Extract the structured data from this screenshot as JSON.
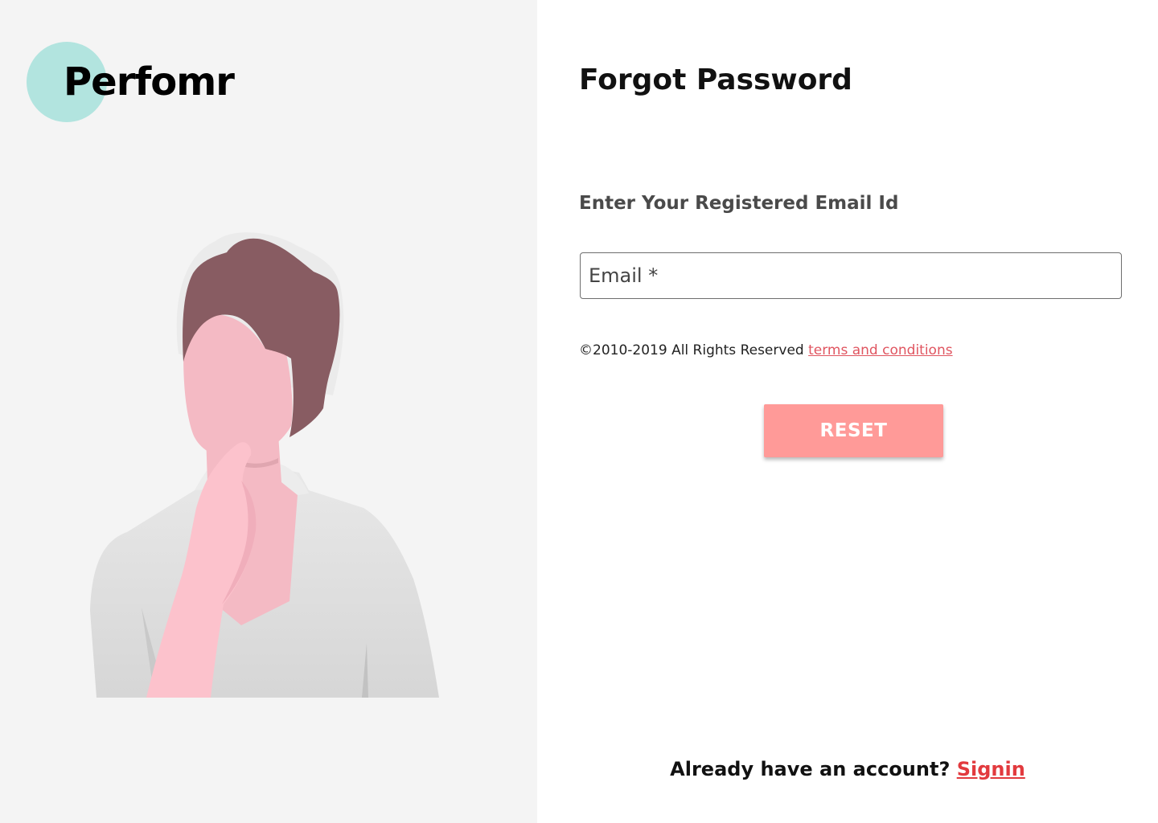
{
  "brand": {
    "name": "Perfomr",
    "circle_color": "#b2e4df"
  },
  "illustration": {
    "subject": "person-thinking-illustration",
    "hair_color": "#885c62",
    "skin_color": "#f4bac4",
    "hand_color": "#fcc2cc",
    "shirt_color": "#e0e0e0"
  },
  "form": {
    "title": "Forgot Password",
    "field_heading": "Enter Your Registered Email Id",
    "email_placeholder": "Email *",
    "email_value": ""
  },
  "footer_note": {
    "copyright": "©2010-2019 All Rights Reserved",
    "terms_link": "terms and conditions",
    "terms_color": "#e05560"
  },
  "actions": {
    "reset_label": "RESET",
    "reset_color": "#ff9a98"
  },
  "signin": {
    "prompt": "Already have an account?",
    "link_label": "Signin",
    "link_color": "#e23a3e"
  }
}
